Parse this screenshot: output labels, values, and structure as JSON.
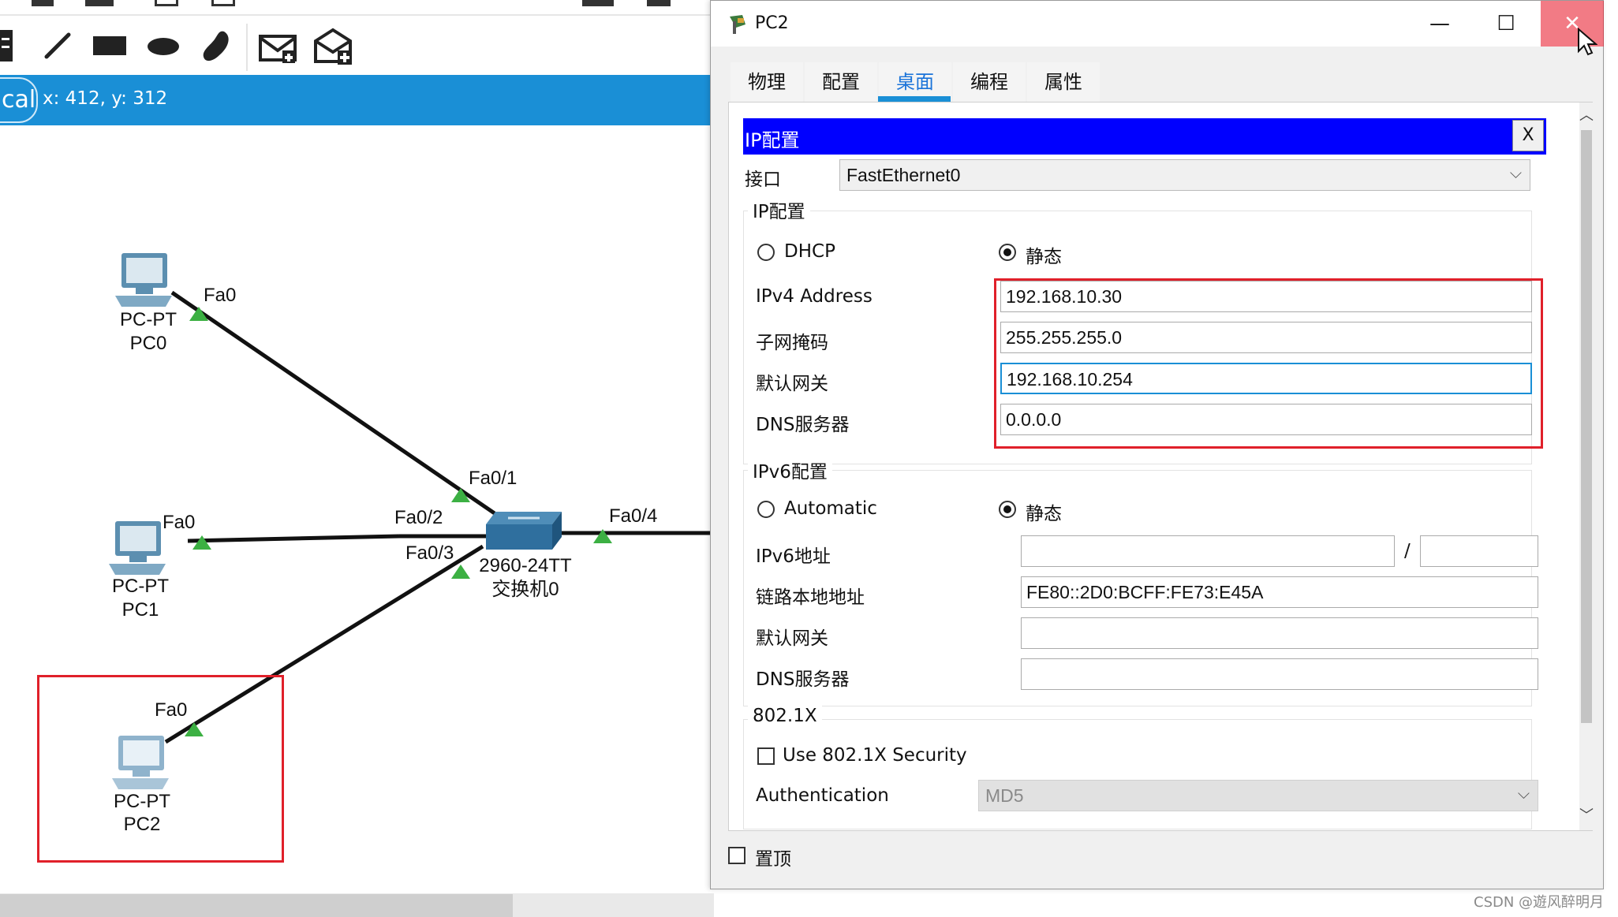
{
  "workspace": {
    "mode_label": "cal",
    "coords_text": "x: 412, y: 312",
    "devices": [
      {
        "type_label": "PC-PT",
        "name": "PC0",
        "port": "Fa0"
      },
      {
        "type_label": "PC-PT",
        "name": "PC1",
        "port": "Fa0"
      },
      {
        "type_label": "PC-PT",
        "name": "PC2",
        "port": "Fa0"
      }
    ],
    "switch": {
      "model": "2960-24TT",
      "name": "交换机0"
    },
    "switch_ports": [
      "Fa0/1",
      "Fa0/2",
      "Fa0/3",
      "Fa0/4"
    ],
    "link_color": "#111111",
    "port_up_color": "#3cb043"
  },
  "dialog": {
    "title": "PC2",
    "tabs": [
      {
        "label": "物理",
        "active": false
      },
      {
        "label": "配置",
        "active": false
      },
      {
        "label": "桌面",
        "active": true
      },
      {
        "label": "编程",
        "active": false
      },
      {
        "label": "属性",
        "active": false
      }
    ],
    "ip_config_header": "IP配置",
    "close_x": "X",
    "interface_label": "接口",
    "interface_value": "FastEthernet0",
    "ipv4": {
      "group_title": "IP配置",
      "dhcp_label": "DHCP",
      "static_label": "静态",
      "static_selected": true,
      "address_label": "IPv4 Address",
      "address_value": "192.168.10.30",
      "subnet_label": "子网掩码",
      "subnet_value": "255.255.255.0",
      "gateway_label": "默认网关",
      "gateway_value": "192.168.10.254",
      "dns_label": "DNS服务器",
      "dns_value": "0.0.0.0"
    },
    "ipv6": {
      "group_title": "IPv6配置",
      "auto_label": "Automatic",
      "static_label": "静态",
      "static_selected": true,
      "address_label": "IPv6地址",
      "address_value": "",
      "prefix_separator": "/",
      "prefix_value": "",
      "link_local_label": "链路本地地址",
      "link_local_value": "FE80::2D0:BCFF:FE73:E45A",
      "gateway_label": "默认网关",
      "gateway_value": "",
      "dns_label": "DNS服务器",
      "dns_value": ""
    },
    "dot1x": {
      "group_title": "802.1X",
      "use_label": "Use 802.1X Security",
      "use_checked": false,
      "auth_label": "Authentication",
      "auth_value": "MD5"
    },
    "pin_label": "置顶",
    "pin_checked": false,
    "header_color": "#0000ff",
    "tab_accent": "#1a8fd6",
    "highlight_color": "#e0202a"
  },
  "watermark": "CSDN @遊风醉明月"
}
